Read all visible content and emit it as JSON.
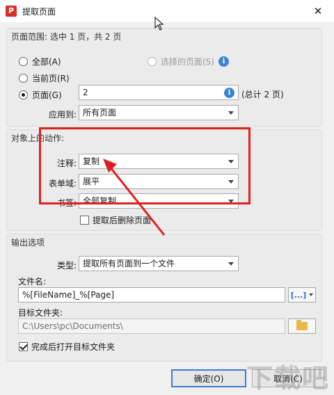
{
  "window": {
    "app_icon_letter": "P",
    "title": "提取页面",
    "close_glyph": "✕"
  },
  "page_range": {
    "title": "页面范围: 选中 1 页，共 2 页",
    "all_label": "全部(A)",
    "selected_label": "选择的页面(S)",
    "current_label": "当前页(R)",
    "pages_label": "页面(G)",
    "pages_value": "2",
    "total_label": "(总计 2 页)",
    "apply_to_label": "应用到:",
    "apply_to_value": "所有页面",
    "info_glyph": "i"
  },
  "actions": {
    "title": "对象上的动作:",
    "annotation_label": "注释:",
    "annotation_value": "复制",
    "form_field_label": "表单域:",
    "form_field_value": "展平",
    "bookmark_label": "书签:",
    "bookmark_value": "全部复制",
    "delete_after_label": "提取后删除页面"
  },
  "output": {
    "title": "输出选项",
    "type_label": "类型:",
    "type_value": "提取所有页面到一个文件",
    "filename_label": "文件名:",
    "filename_value": "%[FileName]_%[Page]",
    "macro_button_label": "[...]",
    "target_folder_label": "目标文件夹:",
    "target_folder_value": "C:\\Users\\pc\\Documents\\",
    "open_after_label": "完成后打开目标文件夹"
  },
  "buttons": {
    "ok": "确定(O)",
    "cancel": "取消(C)"
  },
  "watermark": "下载吧",
  "colors": {
    "highlight": "#e02020",
    "info": "#3a84d6"
  }
}
